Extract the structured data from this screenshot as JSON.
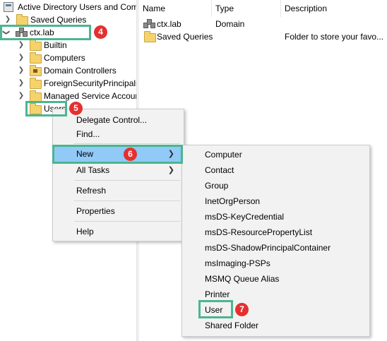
{
  "tree": {
    "root_label": "Active Directory Users and Com",
    "saved_queries": "Saved Queries",
    "domain": "ctx.lab",
    "children": [
      "Builtin",
      "Computers",
      "Domain Controllers",
      "ForeignSecurityPrincipals",
      "Managed Service Accour",
      "Users"
    ]
  },
  "list": {
    "columns": [
      "Name",
      "Type",
      "Description"
    ],
    "rows": [
      {
        "name": "ctx.lab",
        "type": "Domain",
        "description": ""
      },
      {
        "name": "Saved Queries",
        "type": "",
        "description": "Folder to store your favo..."
      }
    ]
  },
  "context_menu": {
    "items": [
      "Delegate Control...",
      "Find...",
      "New",
      "All Tasks",
      "Refresh",
      "Properties",
      "Help"
    ]
  },
  "submenu": {
    "items": [
      "Computer",
      "Contact",
      "Group",
      "InetOrgPerson",
      "msDS-KeyCredential",
      "msDS-ResourcePropertyList",
      "msDS-ShadowPrincipalContainer",
      "msImaging-PSPs",
      "MSMQ Queue Alias",
      "Printer",
      "User",
      "Shared Folder"
    ]
  },
  "callouts": {
    "domain": "4",
    "users": "5",
    "new": "6",
    "user": "7"
  },
  "colors": {
    "callout_border": "#4cb58f",
    "badge": "#e53030",
    "highlight": "#91c9f7"
  }
}
